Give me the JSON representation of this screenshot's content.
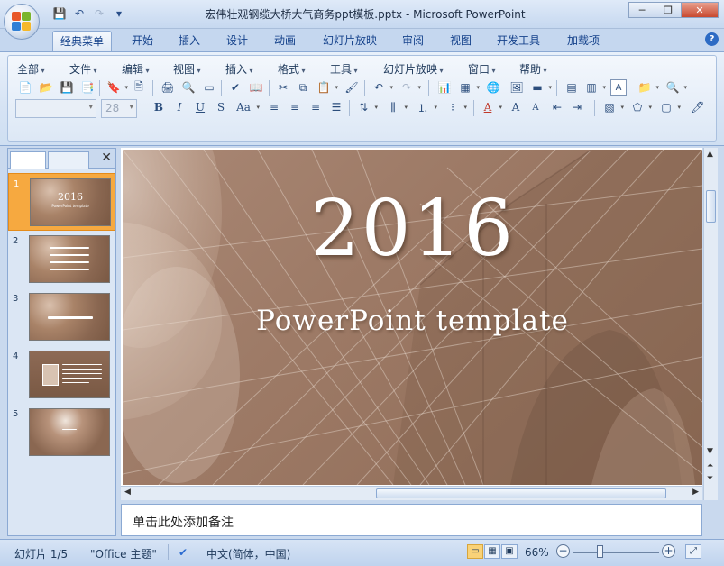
{
  "window": {
    "title": "宏伟壮观钢缆大桥大气商务ppt模板.pptx - Microsoft PowerPoint",
    "minimize": "─",
    "restore": "❐",
    "close": "✕"
  },
  "quick_access": {
    "save_icon": "💾",
    "undo_icon": "↶",
    "redo_icon": "↷",
    "customize_icon": "▾"
  },
  "ribbon_tabs": [
    {
      "label": "经典菜单",
      "active": true
    },
    {
      "label": "开始"
    },
    {
      "label": "插入"
    },
    {
      "label": "设计"
    },
    {
      "label": "动画"
    },
    {
      "label": "幻灯片放映"
    },
    {
      "label": "审阅"
    },
    {
      "label": "视图"
    },
    {
      "label": "开发工具"
    },
    {
      "label": "加载项"
    }
  ],
  "help": "?",
  "classic_menu": [
    "全部",
    "文件",
    "编辑",
    "视图",
    "插入",
    "格式",
    "工具",
    "幻灯片放映",
    "窗口",
    "帮助"
  ],
  "formatting": {
    "font_name": "",
    "font_size": "28",
    "bold": "B",
    "italic": "I",
    "underline": "U",
    "strike": "S",
    "case": "Aa",
    "font_color": "A",
    "grow": "A",
    "shrink": "A"
  },
  "slide_pane": {
    "close": "✕",
    "slides": [
      {
        "num": "1",
        "title": "2016",
        "sub": "PowerPoint template",
        "selected": true
      },
      {
        "num": "2"
      },
      {
        "num": "3"
      },
      {
        "num": "4"
      },
      {
        "num": "5"
      }
    ]
  },
  "slide": {
    "title": "2016",
    "subtitle": "PowerPoint template"
  },
  "notes": {
    "placeholder": "单击此处添加备注"
  },
  "status": {
    "slide_info": "幻灯片 1/5",
    "theme": "\"Office 主题\"",
    "language": "中文(简体，中国)",
    "zoom": "66%",
    "zoom_out": "−",
    "zoom_in": "+"
  }
}
